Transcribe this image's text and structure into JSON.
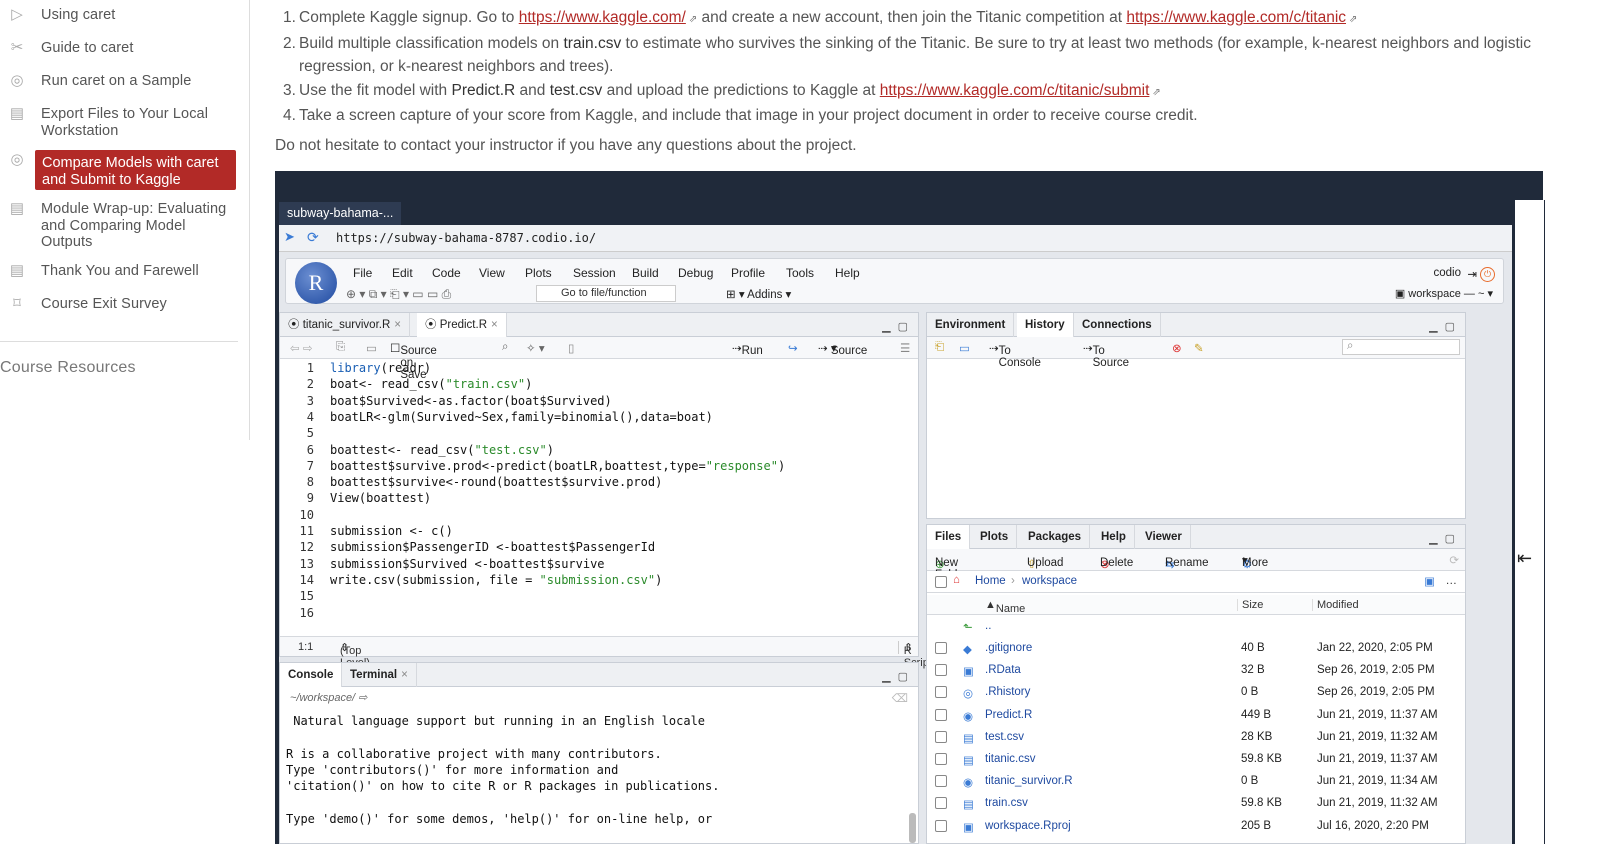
{
  "sidebar": {
    "items": [
      {
        "label": "Using caret",
        "icon": "play-icon"
      },
      {
        "label": "Guide to caret",
        "icon": "tools-icon"
      },
      {
        "label": "Run caret on a Sample",
        "icon": "target-icon"
      },
      {
        "label": "Export Files to Your Local Workstation",
        "icon": "book-icon"
      },
      {
        "label": "Compare Models with caret and Submit to Kaggle",
        "icon": "target-icon",
        "active": true
      },
      {
        "label": "Module Wrap-up: Evaluating and Comparing Model Outputs",
        "icon": "book-icon"
      },
      {
        "label": "Thank You and Farewell",
        "icon": "book-icon"
      },
      {
        "label": "Course Exit Survey",
        "icon": "bookmark-icon"
      }
    ],
    "resources_heading": "Course Resources"
  },
  "main": {
    "steps": [
      {
        "num": "1.",
        "pre": "Complete Kaggle signup. Go to ",
        "link1": "https://www.kaggle.com/",
        "mid": " and create a new account, then join the Titanic competition at ",
        "link2": "https://www.kaggle.com/c/titanic"
      },
      {
        "num": "2.",
        "pre": "Build multiple classification models on ",
        "bold": "train.csv",
        "post": " to estimate who survives the sinking of the Titanic. Be sure to try at least two methods (for example, k-nearest neighbors and logistic regression, or k-nearest neighbors and trees)."
      },
      {
        "num": "3.",
        "pre": "Use the fit model with ",
        "b1": "Predict.R",
        "m1": " and ",
        "b2": "test.csv",
        "m2": " and upload the predictions to Kaggle at ",
        "link1": "https://www.kaggle.com/c/titanic/submit"
      },
      {
        "num": "4.",
        "pre": "Take a screen capture of your score from Kaggle, and include that image in your project document in order to receive course credit."
      }
    ],
    "note": "Do not hesitate to contact your instructor if you have any questions about the project."
  },
  "browser": {
    "tab": "subway-bahama-...",
    "url": "https://subway-bahama-8787.codio.io/"
  },
  "rstudio": {
    "menu": [
      "File",
      "Edit",
      "Code",
      "View",
      "Plots",
      "Session",
      "Build",
      "Debug",
      "Profile",
      "Tools",
      "Help"
    ],
    "goto_placeholder": "Go to file/function",
    "addins": "Addins",
    "user": "codio",
    "project": "workspace — ~",
    "editor": {
      "tabs": [
        "titanic_survivor.R",
        "Predict.R"
      ],
      "source_on_save": "Source on Save",
      "run": "Run",
      "source": "Source",
      "lines": [
        "library(readr)",
        "boat<- read_csv(\"train.csv\")",
        "boat$Survived<-as.factor(boat$Survived)",
        "boatLR<-glm(Survived~Sex,family=binomial(),data=boat)",
        "",
        "boattest<- read_csv(\"test.csv\")",
        "boattest$survive.prod<-predict(boatLR,boattest,type=\"response\")",
        "boattest$survive<-round(boattest$survive.prod)",
        "View(boattest)",
        "",
        "submission <- c()",
        "submission$PassengerID <-boattest$PassengerId",
        "submission$Survived <-boattest$survive",
        "write.csv(submission, file = \"submission.csv\")",
        "",
        ""
      ],
      "status_pos": "1:1",
      "status_scope": "(Top Level)",
      "status_type": "R Script"
    },
    "console": {
      "tabs": [
        "Console",
        "Terminal"
      ],
      "path": "~/workspace/",
      "text": " Natural language support but running in an English locale\n\nR is a collaborative project with many contributors.\nType 'contributors()' for more information and\n'citation()' on how to cite R or R packages in publications.\n\nType 'demo()' for some demos, 'help()' for on-line help, or"
    },
    "env": {
      "tabs": [
        "Environment",
        "History",
        "Connections"
      ],
      "to_console": "To Console",
      "to_source": "To Source"
    },
    "files": {
      "tabs": [
        "Files",
        "Plots",
        "Packages",
        "Help",
        "Viewer"
      ],
      "actions": [
        "New Folder",
        "Upload",
        "Delete",
        "Rename",
        "More"
      ],
      "crumb_home": "Home",
      "crumb_ws": "workspace",
      "headers": [
        "Name",
        "Size",
        "Modified"
      ],
      "up": "..",
      "rows": [
        {
          "name": ".gitignore",
          "size": "40 B",
          "modified": "Jan 22, 2020, 2:05 PM"
        },
        {
          "name": ".RData",
          "size": "32 B",
          "modified": "Sep 26, 2019, 2:05 PM"
        },
        {
          "name": ".Rhistory",
          "size": "0 B",
          "modified": "Sep 26, 2019, 2:05 PM"
        },
        {
          "name": "Predict.R",
          "size": "449 B",
          "modified": "Jun 21, 2019, 11:37 AM"
        },
        {
          "name": "test.csv",
          "size": "28 KB",
          "modified": "Jun 21, 2019, 11:32 AM"
        },
        {
          "name": "titanic.csv",
          "size": "59.8 KB",
          "modified": "Jun 21, 2019, 11:37 AM"
        },
        {
          "name": "titanic_survivor.R",
          "size": "0 B",
          "modified": "Jun 21, 2019, 11:34 AM"
        },
        {
          "name": "train.csv",
          "size": "59.8 KB",
          "modified": "Jun 21, 2019, 11:32 AM"
        },
        {
          "name": "workspace.Rproj",
          "size": "205 B",
          "modified": "Jul 16, 2020, 2:20 PM"
        }
      ]
    }
  }
}
